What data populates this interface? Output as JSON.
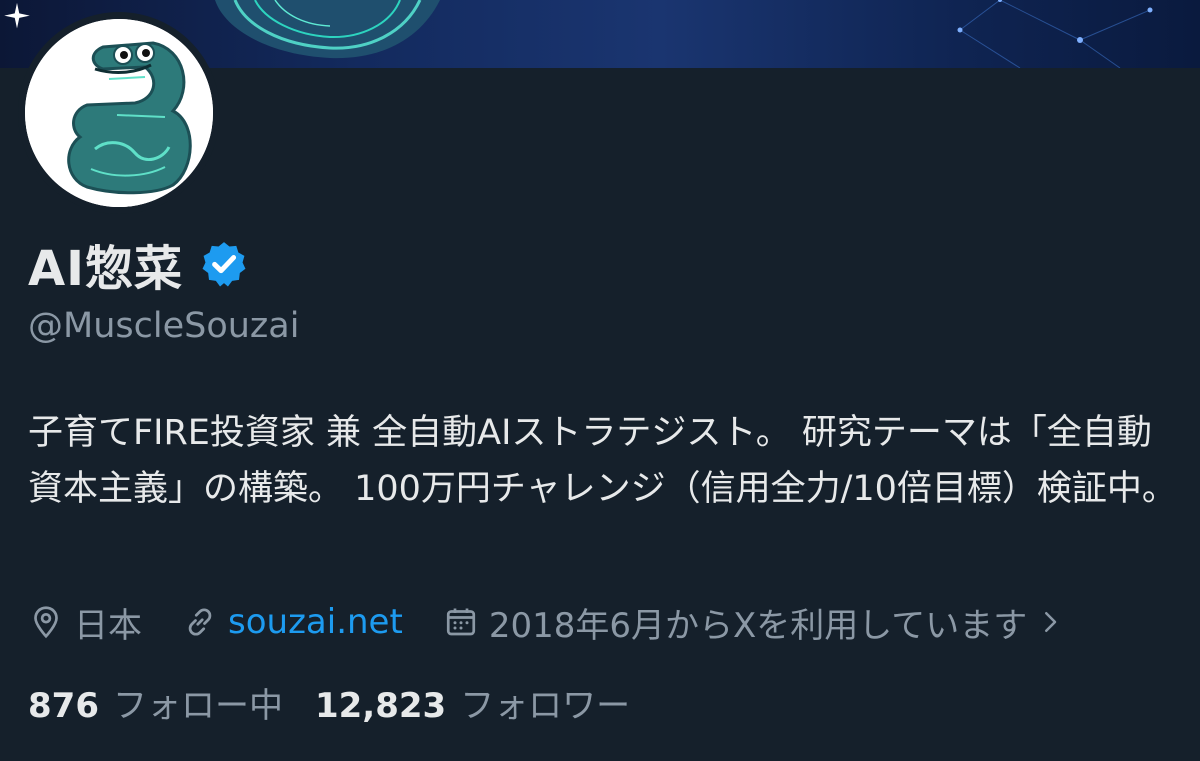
{
  "profile": {
    "display_name": "AI惣菜",
    "handle": "@MuscleSouzai",
    "bio": "子育てFIRE投資家 兼 全自動AIストラテジスト。 研究テーマは「全自動資本主義」の構築。 100万円チャレンジ（信用全力/10倍目標）検証中。",
    "verified": true
  },
  "meta": {
    "location": "日本",
    "website": "souzai.net",
    "joined": "2018年6月からXを利用しています"
  },
  "stats": {
    "following_count": "876",
    "following_label": "フォロー中",
    "followers_count": "12,823",
    "followers_label": "フォロワー"
  },
  "colors": {
    "background": "#15202b",
    "accent": "#1d9bf0",
    "secondary_text": "#8b98a5",
    "primary_text": "#e7e9ea"
  },
  "icons": [
    "sparkle-icon",
    "verified-badge-icon",
    "location-pin-icon",
    "link-icon",
    "calendar-icon",
    "chevron-right-icon"
  ]
}
